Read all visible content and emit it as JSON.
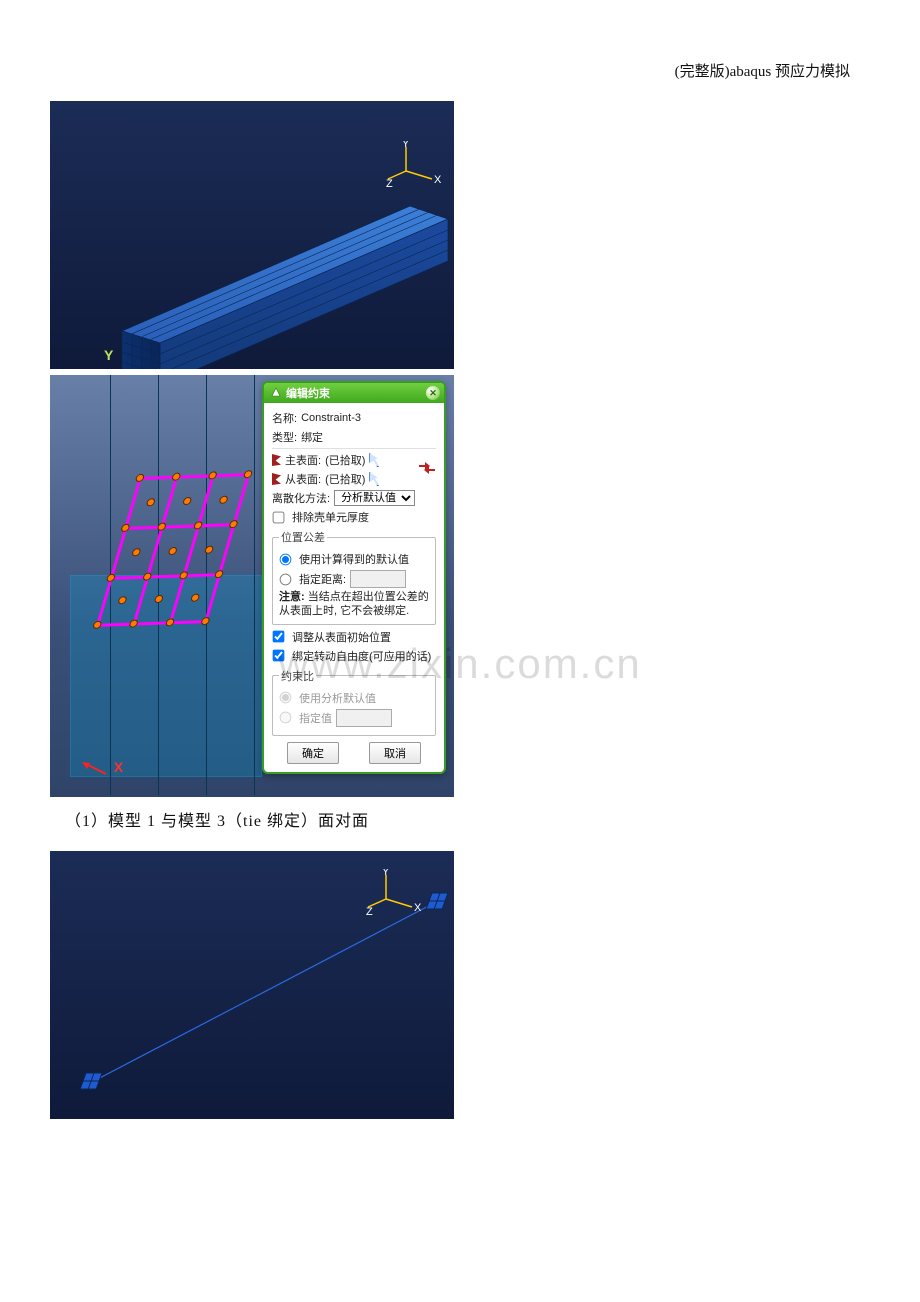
{
  "header_note": "(完整版)abaqus 预应力模拟",
  "caption1": "（1）模型 1 与模型 3（tie 绑定）面对面",
  "watermark": "www.zixin.com.cn",
  "fig1": {
    "corner_label": "Y",
    "axis": {
      "x": "X",
      "y": "Y",
      "z": "Z"
    }
  },
  "fig2": {
    "corner_label": "X"
  },
  "fig3": {
    "axis": {
      "x": "X",
      "y": "Y",
      "z": "Z"
    }
  },
  "dialog": {
    "title": "编辑约束",
    "name_label": "名称:",
    "name_value": "Constraint-3",
    "type_label": "类型:",
    "type_value": "绑定",
    "master_label": "主表面:",
    "master_value": "(已拾取)",
    "slave_label": "从表面:",
    "slave_value": "(已拾取)",
    "disc_label": "离散化方法:",
    "disc_value": "分析默认值",
    "exclude_thickness": "排除壳单元厚度",
    "pos_tol_legend": "位置公差",
    "pos_tol_opt1": "使用计算得到的默认值",
    "pos_tol_opt2": "指定距离:",
    "note_bold": "注意:",
    "note_text": "当结点在超出位置公差的从表面上时, 它不会被绑定.",
    "adjust_label": "调整从表面初始位置",
    "tie_rot_label": "绑定转动自由度(可应用的话)",
    "ratio_legend": "约束比",
    "ratio_opt1": "使用分析默认值",
    "ratio_opt2": "指定值",
    "ok": "确定",
    "cancel": "取消"
  }
}
